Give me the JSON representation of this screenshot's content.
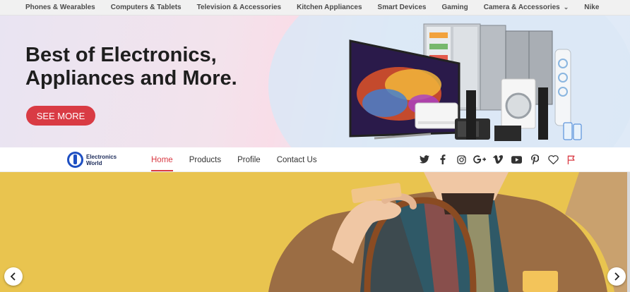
{
  "categories": [
    {
      "label": "Phones & Wearables"
    },
    {
      "label": "Computers & Tablets"
    },
    {
      "label": "Television & Accessories"
    },
    {
      "label": "Kitchen Appliances"
    },
    {
      "label": "Smart Devices"
    },
    {
      "label": "Gaming"
    },
    {
      "label": "Camera & Accessories",
      "has_dropdown": true
    },
    {
      "label": "Nike"
    }
  ],
  "hero": {
    "title_line1": "Best of Electronics,",
    "title_line2": "Appliances and More.",
    "cta_label": "SEE MORE"
  },
  "brand": {
    "line1": "Electronics",
    "line2": "World"
  },
  "menu": [
    {
      "label": "Home",
      "active": true
    },
    {
      "label": "Products"
    },
    {
      "label": "Profile"
    },
    {
      "label": "Contact Us"
    }
  ],
  "social_icons": [
    "twitter-icon",
    "facebook-icon",
    "instagram-icon",
    "google-plus-icon",
    "vimeo-icon",
    "youtube-icon",
    "pinterest-icon",
    "heart-icon",
    "flag-icon"
  ],
  "colors": {
    "accent": "#d93b44",
    "brand_blue": "#1e4fc2",
    "slider_bg": "#e9c44f",
    "text_dark": "#1e1e1e"
  }
}
